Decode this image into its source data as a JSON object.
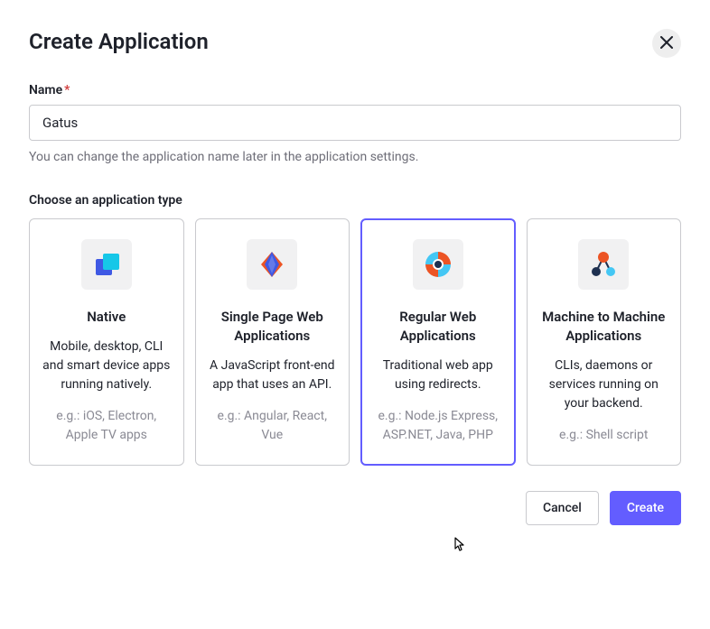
{
  "header": {
    "title": "Create Application"
  },
  "nameField": {
    "label": "Name",
    "requiredMark": "*",
    "value": "Gatus",
    "hint": "You can change the application name later in the application settings."
  },
  "typeSection": {
    "label": "Choose an application type",
    "selectedIndex": 2,
    "cards": [
      {
        "title": "Native",
        "desc": "Mobile, desktop, CLI and smart device apps running natively.",
        "eg": "e.g.: iOS, Electron, Apple TV apps"
      },
      {
        "title": "Single Page Web Applications",
        "desc": "A JavaScript front-end app that uses an API.",
        "eg": "e.g.: Angular, React, Vue"
      },
      {
        "title": "Regular Web Applications",
        "desc": "Traditional web app using redirects.",
        "eg": "e.g.: Node.js Express, ASP.NET, Java, PHP"
      },
      {
        "title": "Machine to Machine Applications",
        "desc": "CLIs, daemons or services running on your backend.",
        "eg": "e.g.: Shell script"
      }
    ]
  },
  "footer": {
    "cancel": "Cancel",
    "create": "Create"
  }
}
